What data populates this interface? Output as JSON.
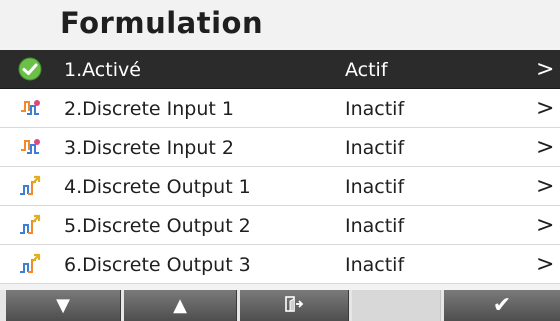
{
  "header": {
    "title": "Formulation"
  },
  "rows": [
    {
      "label": "1.Activé",
      "status": "Actif",
      "icon": "check-circle-icon"
    },
    {
      "label": "2.Discrete Input 1",
      "status": "Inactif",
      "icon": "discrete-input-icon"
    },
    {
      "label": "3.Discrete Input 2",
      "status": "Inactif",
      "icon": "discrete-input-icon"
    },
    {
      "label": "4.Discrete Output 1",
      "status": "Inactif",
      "icon": "discrete-output-icon"
    },
    {
      "label": "5.Discrete Output 2",
      "status": "Inactif",
      "icon": "discrete-output-icon"
    },
    {
      "label": "6.Discrete Output 3",
      "status": "Inactif",
      "icon": "discrete-output-icon"
    }
  ],
  "chevron": ">",
  "toolbar": {
    "down_glyph": "▼",
    "up_glyph": "▲",
    "confirm_glyph": "✔"
  },
  "colors": {
    "selected_row": "#2b2b2b",
    "check_green": "#6cc04a",
    "toolbar_button": "#5f5f5f"
  }
}
